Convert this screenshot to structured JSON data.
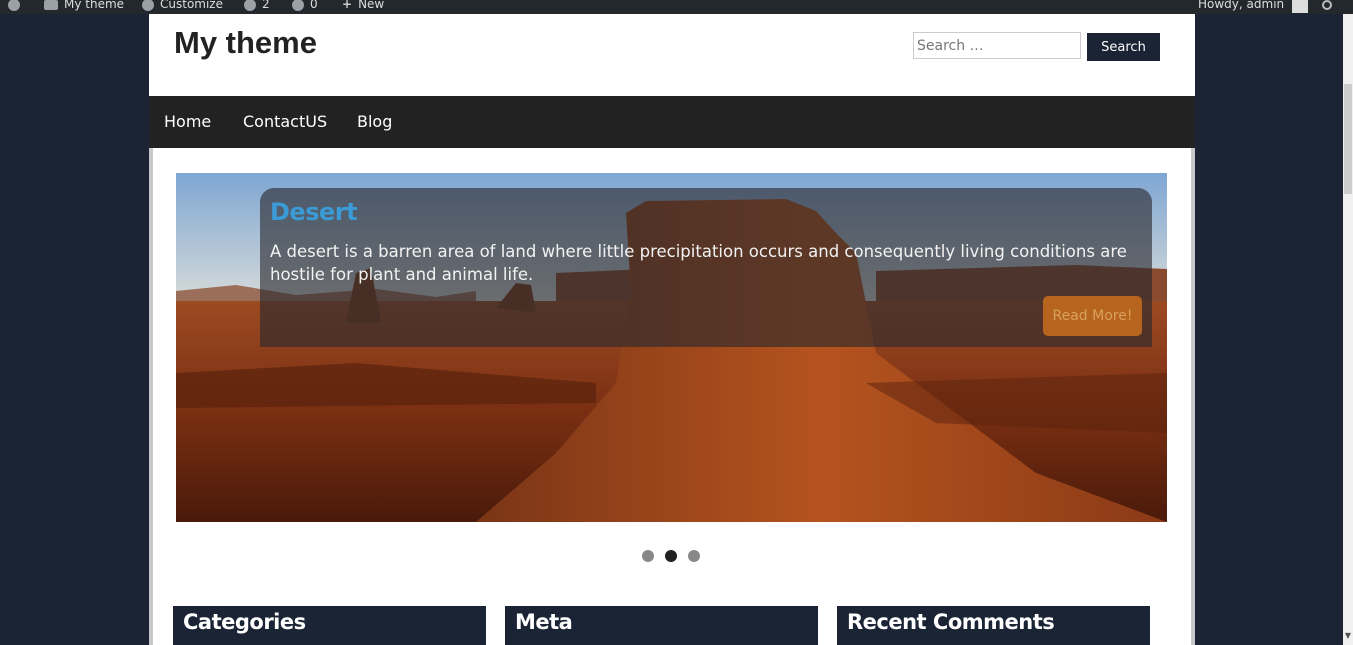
{
  "adminbar": {
    "site_name": "My theme",
    "customize": "Customize",
    "updates_count": "2",
    "comments_count": "0",
    "new_label": "New",
    "howdy": "Howdy, admin"
  },
  "header": {
    "site_title": "My theme",
    "search_placeholder": "Search …",
    "search_button": "Search"
  },
  "nav": {
    "items": [
      {
        "label": "Home"
      },
      {
        "label": "ContactUS"
      },
      {
        "label": "Blog"
      }
    ]
  },
  "slider": {
    "title": "Desert",
    "text": "A desert is a barren area of land where little precipitation occurs and consequently living conditions are hostile for plant and animal life.",
    "read_more": "Read More!",
    "active_slide": 2,
    "slide_count": 3
  },
  "widgets": [
    {
      "title": "Categories"
    },
    {
      "title": "Meta"
    },
    {
      "title": "Recent Comments"
    }
  ],
  "colors": {
    "page_bg": "#1b2434",
    "caption_title": "#3b9bd7",
    "read_more_bg": "#b7651e",
    "nav_bg": "#222222"
  }
}
